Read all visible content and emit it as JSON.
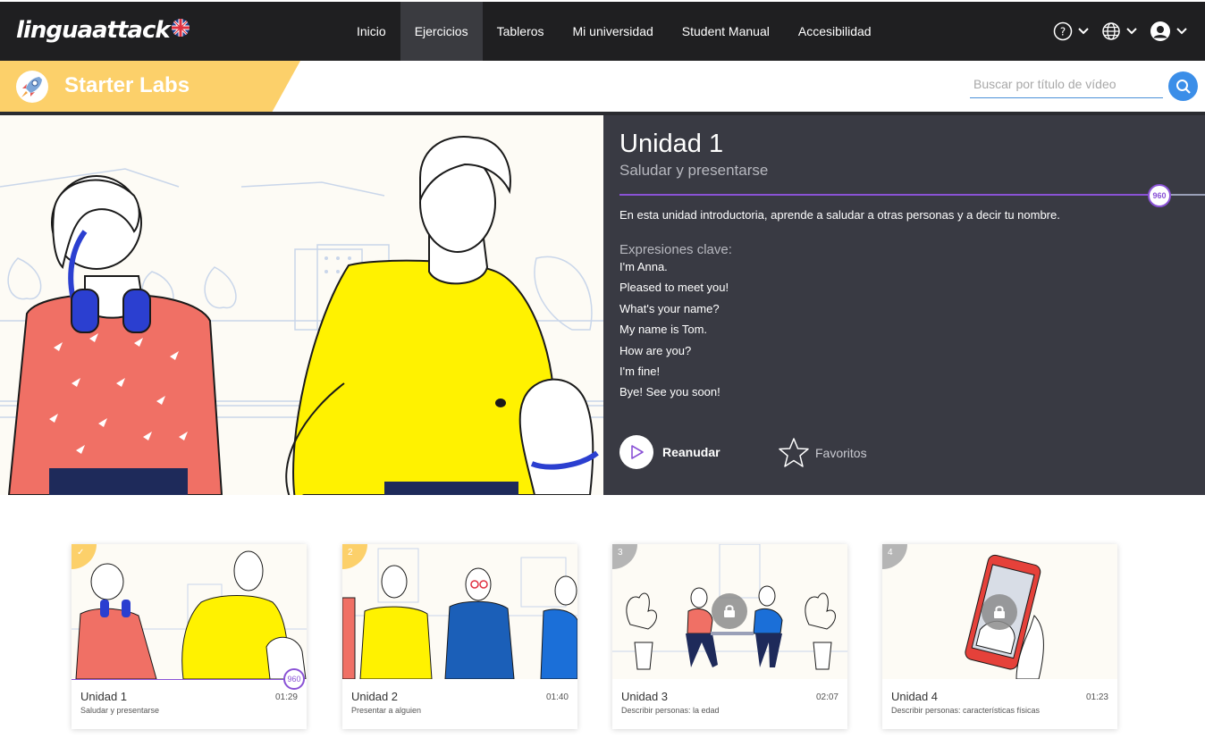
{
  "header": {
    "logo_text": "linguaattack",
    "nav": [
      {
        "label": "Inicio",
        "active": false
      },
      {
        "label": "Ejercicios",
        "active": true
      },
      {
        "label": "Tableros",
        "active": false
      },
      {
        "label": "Mi universidad",
        "active": false
      },
      {
        "label": "Student Manual",
        "active": false
      },
      {
        "label": "Accesibilidad",
        "active": false
      }
    ],
    "icons": [
      "help-icon",
      "globe-icon",
      "user-icon"
    ]
  },
  "subheader": {
    "title": "Starter Labs",
    "search_placeholder": "Buscar por título de vídeo",
    "band_color": "#fcd06a"
  },
  "hero": {
    "title": "Unidad 1",
    "subtitle": "Saludar y presentarse",
    "progress_label": "960",
    "progress_fraction": 0.93,
    "description": "En esta unidad introductoria, aprende a saludar a otras personas y a decir tu nombre.",
    "expressions_label": "Expresiones clave:",
    "expressions": [
      "I'm Anna.",
      "Pleased to meet you!",
      "What's your name?",
      "My name is Tom.",
      "How are you?",
      "I'm fine!",
      "Bye! See you soon!"
    ],
    "resume_label": "Reanudar",
    "favorites_label": "Favoritos"
  },
  "cards": [
    {
      "badge": "✓",
      "title": "Unidad 1",
      "subtitle": "Saludar y presentarse",
      "duration": "01:29",
      "progress_label": "960",
      "progress_fraction": 0.92,
      "locked": false,
      "badge_color": "#fcd06a"
    },
    {
      "badge": "2",
      "title": "Unidad 2",
      "subtitle": "Presentar a alguien",
      "duration": "01:40",
      "locked": false,
      "badge_color": "#fcd06a"
    },
    {
      "badge": "3",
      "title": "Unidad 3",
      "subtitle": "Describir personas: la edad",
      "duration": "02:07",
      "locked": true,
      "badge_color": "#b5b5b5"
    },
    {
      "badge": "4",
      "title": "Unidad 4",
      "subtitle": "Describir personas: características físicas",
      "duration": "01:23",
      "locked": true,
      "badge_color": "#b5b5b5"
    }
  ],
  "colors": {
    "topbar": "#1f1f21",
    "panel": "#393a43",
    "accent": "#8a52d6",
    "search_button": "#3b8ee8"
  }
}
